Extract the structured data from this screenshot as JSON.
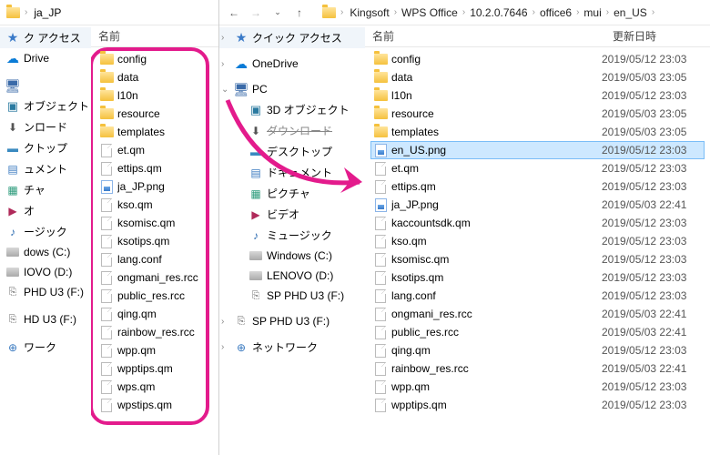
{
  "left": {
    "topbar_folder": "ja_JP",
    "col_name": "名前",
    "sidebar": [
      {
        "type": "header",
        "label": "ク アクセス",
        "icon": "star"
      },
      {
        "type": "item",
        "label": "Drive",
        "icon": "onedrive"
      },
      {
        "type": "blank"
      },
      {
        "type": "item",
        "label": "",
        "icon": "pc"
      },
      {
        "type": "item",
        "label": "オブジェクト",
        "icon": "3d"
      },
      {
        "type": "item",
        "label": "ンロード",
        "icon": "dl"
      },
      {
        "type": "item",
        "label": "クトップ",
        "icon": "desk"
      },
      {
        "type": "item",
        "label": "ュメント",
        "icon": "doc"
      },
      {
        "type": "item",
        "label": "チャ",
        "icon": "pic"
      },
      {
        "type": "item",
        "label": "オ",
        "icon": "vid"
      },
      {
        "type": "item",
        "label": "ージック",
        "icon": "mus"
      },
      {
        "type": "item",
        "label": "dows (C:)",
        "icon": "drive"
      },
      {
        "type": "item",
        "label": "IOVO (D:)",
        "icon": "drive"
      },
      {
        "type": "item",
        "label": "PHD U3 (F:)",
        "icon": "usb"
      },
      {
        "type": "blank"
      },
      {
        "type": "item",
        "label": "HD U3 (F:)",
        "icon": "usb"
      },
      {
        "type": "blank"
      },
      {
        "type": "item",
        "label": "ワーク",
        "icon": "net"
      }
    ],
    "files": [
      {
        "name": "config",
        "icon": "folder"
      },
      {
        "name": "data",
        "icon": "folder"
      },
      {
        "name": "l10n",
        "icon": "folder"
      },
      {
        "name": "resource",
        "icon": "folder"
      },
      {
        "name": "templates",
        "icon": "folder"
      },
      {
        "name": "et.qm",
        "icon": "file"
      },
      {
        "name": "ettips.qm",
        "icon": "file"
      },
      {
        "name": "ja_JP.png",
        "icon": "png"
      },
      {
        "name": "kso.qm",
        "icon": "file"
      },
      {
        "name": "ksomisc.qm",
        "icon": "file"
      },
      {
        "name": "ksotips.qm",
        "icon": "file"
      },
      {
        "name": "lang.conf",
        "icon": "file"
      },
      {
        "name": "ongmani_res.rcc",
        "icon": "file"
      },
      {
        "name": "public_res.rcc",
        "icon": "file"
      },
      {
        "name": "qing.qm",
        "icon": "file"
      },
      {
        "name": "rainbow_res.rcc",
        "icon": "file"
      },
      {
        "name": "wpp.qm",
        "icon": "file"
      },
      {
        "name": "wpptips.qm",
        "icon": "file"
      },
      {
        "name": "wps.qm",
        "icon": "file"
      },
      {
        "name": "wpstips.qm",
        "icon": "file"
      }
    ]
  },
  "right": {
    "breadcrumb": [
      "Kingsoft",
      "WPS Office",
      "10.2.0.7646",
      "office6",
      "mui",
      "en_US"
    ],
    "col_name": "名前",
    "col_date": "更新日時",
    "sidebar": [
      {
        "type": "header",
        "label": "クイック アクセス",
        "icon": "star",
        "exp": true
      },
      {
        "type": "blank"
      },
      {
        "type": "item",
        "label": "OneDrive",
        "icon": "onedrive",
        "exp": true
      },
      {
        "type": "blank"
      },
      {
        "type": "item",
        "label": "PC",
        "icon": "pc",
        "exp": true,
        "open": true
      },
      {
        "type": "child",
        "label": "3D オブジェクト",
        "icon": "3d"
      },
      {
        "type": "child",
        "label": "ダウンロード",
        "icon": "dl",
        "strike": true
      },
      {
        "type": "child",
        "label": "デスクトップ",
        "icon": "desk"
      },
      {
        "type": "child",
        "label": "ドキュメント",
        "icon": "doc"
      },
      {
        "type": "child",
        "label": "ピクチャ",
        "icon": "pic"
      },
      {
        "type": "child",
        "label": "ビデオ",
        "icon": "vid"
      },
      {
        "type": "child",
        "label": "ミュージック",
        "icon": "mus"
      },
      {
        "type": "child",
        "label": "Windows (C:)",
        "icon": "drive"
      },
      {
        "type": "child",
        "label": "LENOVO (D:)",
        "icon": "drive"
      },
      {
        "type": "child",
        "label": "SP PHD U3 (F:)",
        "icon": "usb"
      },
      {
        "type": "blank"
      },
      {
        "type": "item",
        "label": "SP PHD U3 (F:)",
        "icon": "usb",
        "exp": true
      },
      {
        "type": "blank"
      },
      {
        "type": "item",
        "label": "ネットワーク",
        "icon": "net",
        "exp": true
      }
    ],
    "files": [
      {
        "name": "config",
        "icon": "folder",
        "date": "2019/05/12 23:03"
      },
      {
        "name": "data",
        "icon": "folder",
        "date": "2019/05/03 23:05"
      },
      {
        "name": "l10n",
        "icon": "folder",
        "date": "2019/05/12 23:03"
      },
      {
        "name": "resource",
        "icon": "folder",
        "date": "2019/05/03 23:05"
      },
      {
        "name": "templates",
        "icon": "folder",
        "date": "2019/05/03 23:05"
      },
      {
        "name": "en_US.png",
        "icon": "png",
        "date": "2019/05/12 23:03",
        "selected": true
      },
      {
        "name": "et.qm",
        "icon": "file",
        "date": "2019/05/12 23:03"
      },
      {
        "name": "ettips.qm",
        "icon": "file",
        "date": "2019/05/12 23:03"
      },
      {
        "name": "ja_JP.png",
        "icon": "png",
        "date": "2019/05/03 22:41"
      },
      {
        "name": "kaccountsdk.qm",
        "icon": "file",
        "date": "2019/05/12 23:03"
      },
      {
        "name": "kso.qm",
        "icon": "file",
        "date": "2019/05/12 23:03"
      },
      {
        "name": "ksomisc.qm",
        "icon": "file",
        "date": "2019/05/12 23:03"
      },
      {
        "name": "ksotips.qm",
        "icon": "file",
        "date": "2019/05/12 23:03"
      },
      {
        "name": "lang.conf",
        "icon": "file",
        "date": "2019/05/12 23:03"
      },
      {
        "name": "ongmani_res.rcc",
        "icon": "file",
        "date": "2019/05/03 22:41"
      },
      {
        "name": "public_res.rcc",
        "icon": "file",
        "date": "2019/05/03 22:41"
      },
      {
        "name": "qing.qm",
        "icon": "file",
        "date": "2019/05/12 23:03"
      },
      {
        "name": "rainbow_res.rcc",
        "icon": "file",
        "date": "2019/05/03 22:41"
      },
      {
        "name": "wpp.qm",
        "icon": "file",
        "date": "2019/05/12 23:03"
      },
      {
        "name": "wpptips.qm",
        "icon": "file",
        "date": "2019/05/12 23:03"
      }
    ]
  }
}
